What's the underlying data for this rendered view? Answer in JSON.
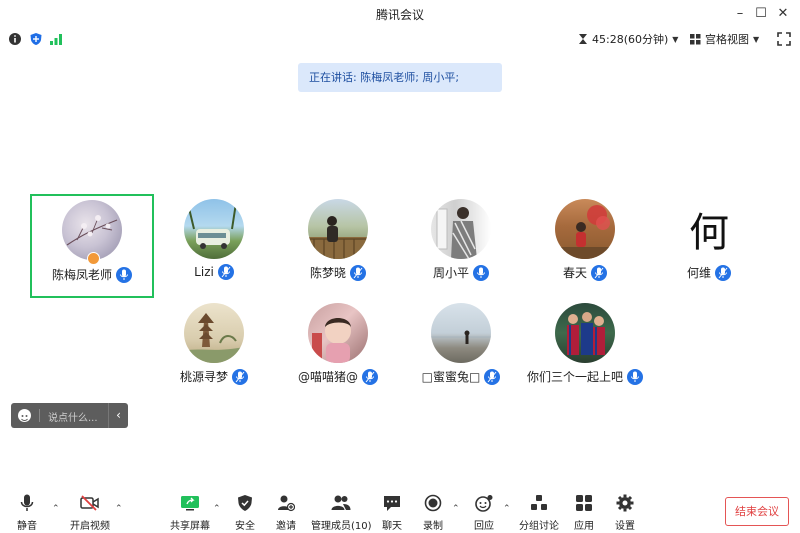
{
  "window": {
    "title": "腾讯会议"
  },
  "topbar": {
    "timer": "45:28(60分钟)",
    "view_mode": "宫格视图"
  },
  "banner": {
    "text": "正在讲话: 陈梅凤老师; 周小平;"
  },
  "participants": [
    {
      "name": "陈梅凤老师"
    },
    {
      "name": "Lizi"
    },
    {
      "name": "陈梦晓"
    },
    {
      "name": "周小平"
    },
    {
      "name": "春天"
    },
    {
      "name": "何维"
    },
    {
      "name": "桃源寻梦"
    },
    {
      "name": "@喵喵猪@"
    },
    {
      "name": "□蜜蜜兔□"
    },
    {
      "name": "你们三个一起上吧"
    }
  ],
  "avatar_char": "何",
  "chat": {
    "placeholder": "说点什么..."
  },
  "toolbar": {
    "mute": "静音",
    "video": "开启视频",
    "share": "共享屏幕",
    "security": "安全",
    "invite": "邀请",
    "members": "管理成员(10)",
    "chat": "聊天",
    "record": "录制",
    "react": "回应",
    "breakout": "分组讨论",
    "apps": "应用",
    "settings": "设置",
    "end": "结束会议"
  },
  "colors": {
    "accent": "#2472e5",
    "speaking_border": "#21c05b",
    "end": "#e03f3f"
  }
}
